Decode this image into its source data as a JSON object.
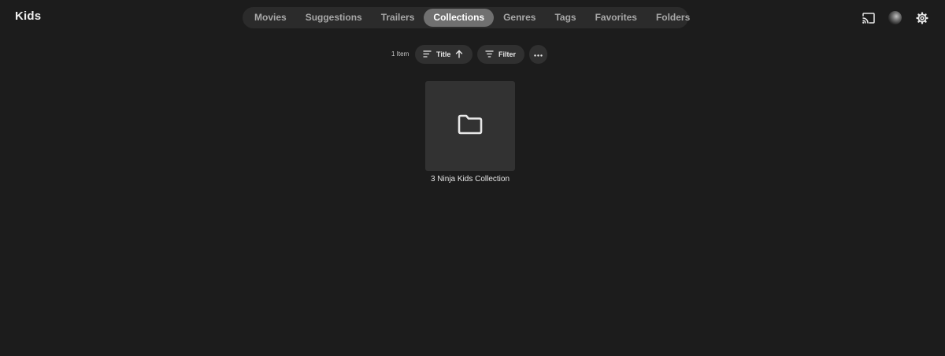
{
  "header": {
    "title": "Kids",
    "tabs": [
      {
        "label": "Movies"
      },
      {
        "label": "Suggestions"
      },
      {
        "label": "Trailers"
      },
      {
        "label": "Collections",
        "active": true
      },
      {
        "label": "Genres"
      },
      {
        "label": "Tags"
      },
      {
        "label": "Favorites"
      },
      {
        "label": "Folders"
      }
    ],
    "icons": [
      "cast-icon",
      "avatar",
      "gear-icon"
    ]
  },
  "toolbar": {
    "item_count": "1 Item",
    "sort_label": "Title",
    "sort_direction": "ascending",
    "filter_label": "Filter"
  },
  "items": [
    {
      "title": "3 Ninja Kids Collection",
      "icon": "folder-icon"
    }
  ],
  "colors": {
    "background": "#1c1c1c",
    "tab_bar": "#2b2b2b",
    "tab_active": "#707070",
    "button": "#303030",
    "card": "#323232"
  }
}
